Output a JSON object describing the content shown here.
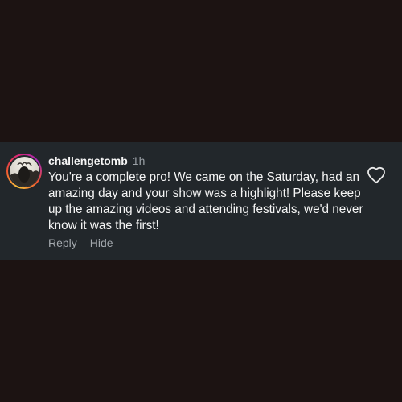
{
  "comment": {
    "username": "challengetomb",
    "time": "1h",
    "text": "You're a complete pro! We came on the Saturday, had an amazing day and your show was a highlight! Please keep up the amazing videos and attending festivals, we'd never know it was the first!",
    "reply_label": "Reply",
    "hide_label": "Hide",
    "like_icon": "heart-outline-icon"
  },
  "colors": {
    "background": "#1c1312",
    "card": "#22272b",
    "text": "#f5f5f5",
    "muted": "#a4a9ae"
  }
}
